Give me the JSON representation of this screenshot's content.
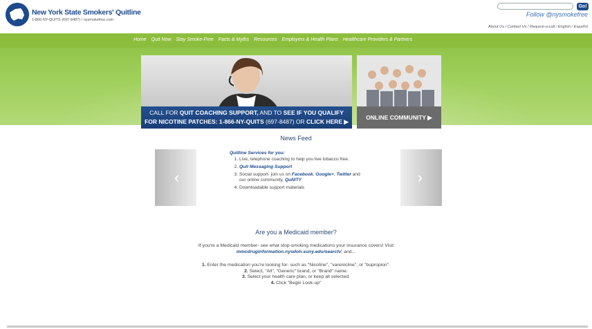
{
  "header": {
    "logo_title": "New York State Smokers' Quitline",
    "logo_sub": "1-866-NY-QUITS (697-8487) / nysmokefree.com",
    "search_placeholder": "",
    "go_label": "Go!",
    "follow": "Follow @nysmokefree",
    "top_links": [
      "About Us",
      "Contact Us",
      "Request-a-call",
      "English",
      "Español"
    ]
  },
  "nav": {
    "items": [
      "Home",
      "Quit Now",
      "Stay Smoke-Free",
      "Facts & Myths",
      "Resources",
      "Employers & Health Plans",
      "Healthcare Providers & Partners"
    ]
  },
  "hero": {
    "line1_pre": "CALL FOR ",
    "line1_b1": "QUIT COACHING SUPPORT,",
    "line1_mid": " AND TO ",
    "line1_b2": "SEE IF YOU QUALIFY",
    "line2_b1": "FOR NICOTINE PATCHES: 1-866-NY-QUITS",
    "line2_mid": " (697-8487) OR ",
    "line2_b2": "CLICK HERE ▶"
  },
  "community": {
    "label": "ONLINE COMMUNITY ▶"
  },
  "news": {
    "title": "News Feed",
    "heading": "Quitline Services for you:",
    "items": {
      "i1": "Live, telephone coaching to help you live tobacco free.",
      "i2": "Quit Messaging Support",
      "i3_pre": "Social support- join us on ",
      "i3_fb": "Facebook",
      "i3_sep": ", ",
      "i3_g": "Google+",
      "i3_comma": ", ",
      "i3_tw": "Twitter",
      "i3_mid": " and our online community, ",
      "i3_q": "QuNITY",
      "i4": "Downloadable support materials"
    },
    "prev": "‹",
    "next": "›"
  },
  "medicaid": {
    "title": "Are you a Medicaid member?",
    "intro1": "If you're a Medicaid member- see what stop-smoking medications your insurance covers! Visit",
    "intro_link": "mmcdruginformation.nysdoh.suny.edu/search/",
    "intro_tail": ", and...",
    "s1_num": "1.",
    "s1": " Enter the medication you're looking for- such as \"Nicotine\", \"varenicline\", or \"bupropion\".",
    "s2_num": "2.",
    "s2": " Select, \"All\", \"Generic\" brand, or \"Brand\" name.",
    "s3_num": "3.",
    "s3": " Select your health care plan, or keep all selected.",
    "s4_num": "4.",
    "s4": " Click \"Begin Look-up\""
  },
  "colors": {
    "brand_blue": "#1c4a8c",
    "nav_green": "#8dbd3d"
  }
}
